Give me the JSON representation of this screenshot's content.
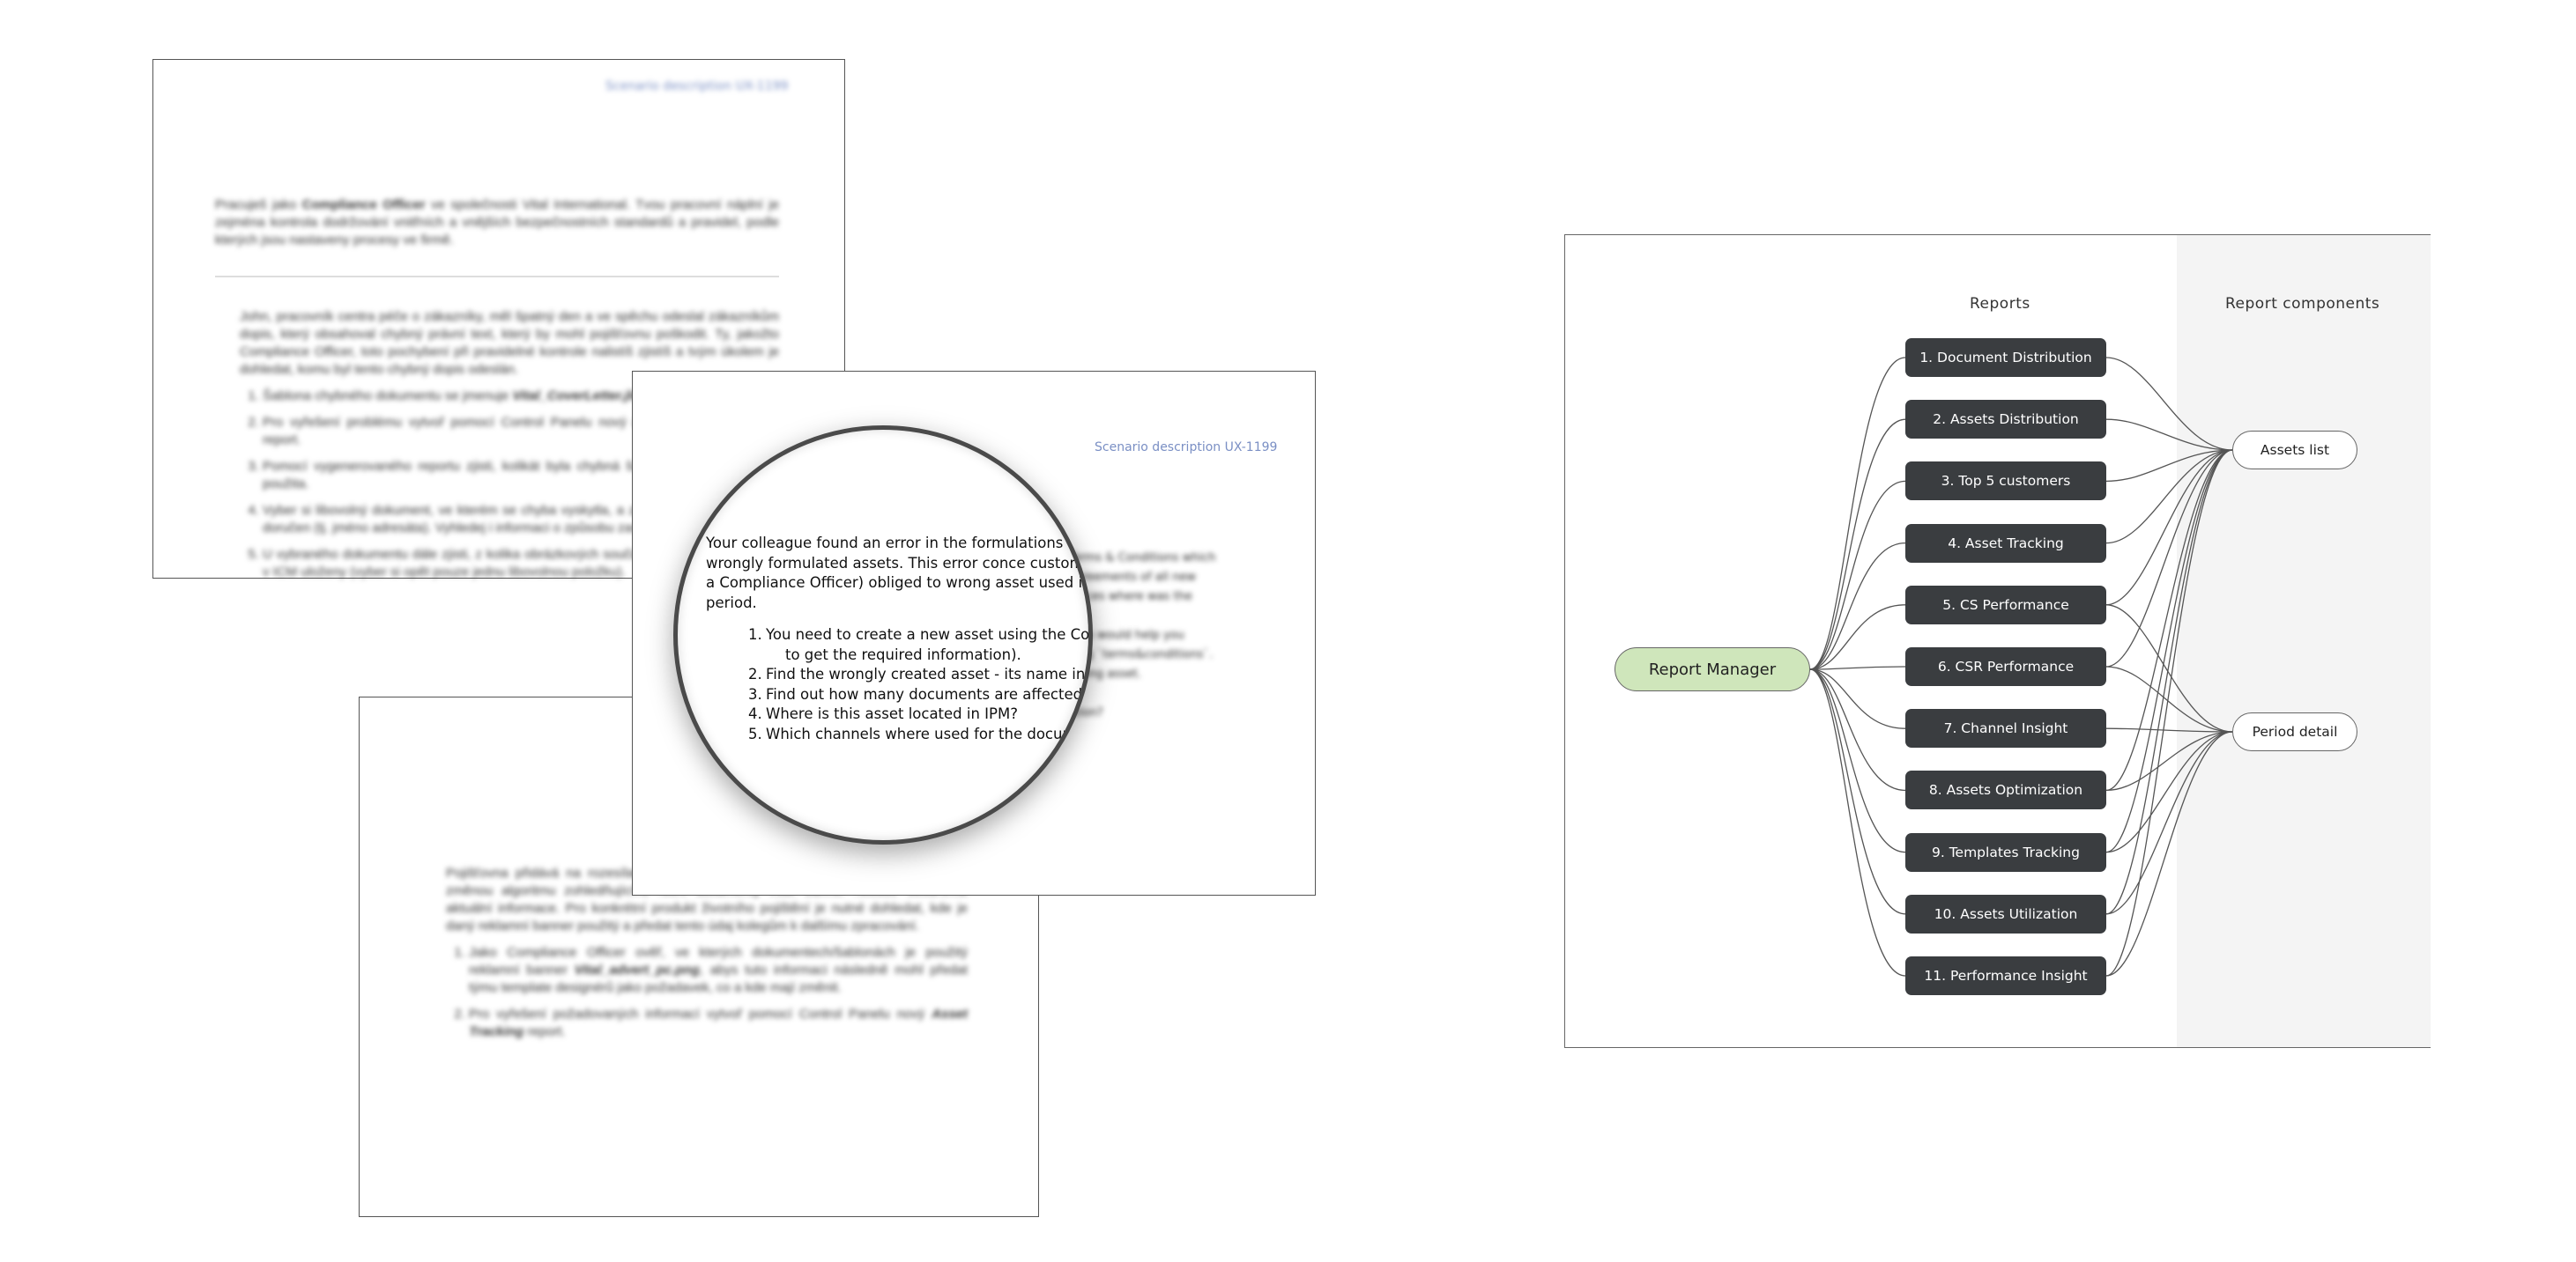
{
  "doc_top_left": {
    "header": "Scenario description UX-1199",
    "intro_html": "Pracuješ jako <b>Compliance Officer</b> ve společnosti Vital International. Tvou pracovní náplní je zejména kontrola dodržování vnitřních a vnějších bezpečnostních standardů a pravidel, podle kterých jsou nastaveny procesy ve firmě.",
    "para": "John, pracovník centra péče o zákazníky, měl špatný den a ve spěchu odeslal zákazníkům dopis, který obsahoval chybný právní text, který by mohl pojišťovnu poškodit. Ty, jakožto Compliance Officer, toto pochybení při pravidelné kontrole nalistíš zjistíš a tvým úkolem je dohledat, komu byl tento chybný dopis odeslán.",
    "items": [
      "Šablona chybného dokumentu se jmenuje <b><i>Vital_CoverLetter.jld</i></b>",
      "Pro vyřešení problému vytvoř pomocí Control Panelu nový <b><i>Document Distribution</i></b> report.",
      "Pomocí vygenerovaného reportu zjisti, kolikát byla chybná šablona v daném období použita.",
      "Vyber si libovolný dokument, ve kterém se chyba vyskytla, a zjisti, kdy byl zákazníkovi doručen (tj. jméno adresáta). Vyhledej i informaci o způsobu zaslání.",
      "U vybraného dokumentu dále zjisti, z kolika obrázkových součástí se skládá a kde jsou v ICM uloženy (vyber si opět pouze jednu libovolnou položku)."
    ]
  },
  "doc_bottom_left": {
    "para": "Pojišťovna přidává na rozesílané dokumenty reklamní banner. Nyní v souvislosti se změnou algoritmu zohledňujícího roční dokumenty však banner nebude obsahovat aktuální informace. Pro konkrétní produkt životního pojištění je nutné dohledat, kde je daný reklamní banner použitý a předat tento údaj kolegům k dalšímu zpracování.",
    "items": [
      "Jako Compliance Officer ověř, ve kterých dokumentech/šablonách je použitý reklamní banner <b><i>Vital_advert_pc.png</i></b>, abys tuto informaci následně mohl předat týmu template designérů jako požadavek, co a kde mají změnit.",
      "Pro vyřešení požadovaných informací vytvoř pomocí Control Panelu nový <b><i>Asset Tracking</i></b> report."
    ]
  },
  "doc_front": {
    "header": "Scenario description UX-1199",
    "right_lines": [
      "Terms & Conditions which",
      "agreements of all new",
      "places where was the",
      "",
      "(this would help you",
      "ding `terms&conditions`.",
      "wrong asset.",
      "",
      "ation?"
    ]
  },
  "magnifier": {
    "intro": "Your colleague  found an error in the formulations of contained wrongly formulated assets. This error conce customers. You are (as a Compliance Officer) obliged to wrong asset used in the given period.",
    "tasks": [
      "You need to create a new asset using the Contr",
      "to get the required information).",
      "Find the wrongly created asset - its name inclu",
      "Find out how many documents are affected b",
      "Where is this asset located in IPM?",
      "Which channels where used for the docum"
    ]
  },
  "diagram": {
    "col_reports": "Reports",
    "col_components": "Report components",
    "manager": "Report Manager",
    "reports": [
      "1. Document Distribution",
      "2. Assets Distribution",
      "3. Top 5 customers",
      "4. Asset Tracking",
      "5. CS Performance",
      "6. CSR Performance",
      "7. Channel Insight",
      "8. Assets Optimization",
      "9. Templates Tracking",
      "10. Assets Utilization",
      "11. Performance Insight"
    ],
    "components": [
      "Assets list",
      "Period detail"
    ],
    "colors": {
      "report_box": "#3a3d40",
      "manager_fill": "#cfe6bb",
      "component_bg": "#f4f4f4"
    }
  }
}
